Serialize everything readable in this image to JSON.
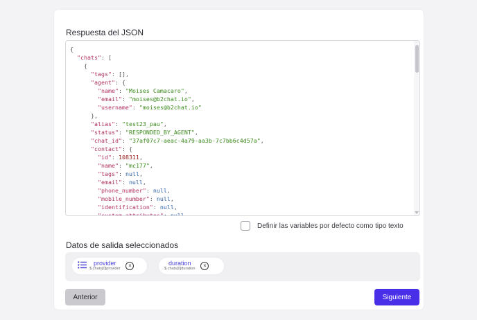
{
  "section_title": "Respuesta del JSON",
  "json_lines": [
    "{",
    "  \"chats\": [",
    "    {",
    "      \"tags\": [],",
    "      \"agent\": {",
    "        \"name\": \"Moises Camacaro\",",
    "        \"email\": \"moises@b2chat.io\",",
    "        \"username\": \"moises@b2chat.io\"",
    "      },",
    "      \"alias\": \"test23_pau\",",
    "      \"status\": \"RESPONDED_BY_AGENT\",",
    "      \"chat_id\": \"37af07c7-aeac-4a79-aa3b-7c7bb6c4d57a\",",
    "      \"contact\": {",
    "        \"id\": 108311,",
    "        \"name\": \"mc177\",",
    "        \"tags\": null,",
    "        \"email\": null,",
    "        \"phone_number\": null,",
    "        \"mobile_number\": null,",
    "        \"identification\": null,",
    "        \"custom_attributes\": null"
  ],
  "checkbox": {
    "label": "Definir las variables por defecto como tipo texto",
    "checked": false
  },
  "output_title": "Datos de salida seleccionados",
  "chips": [
    {
      "name": "provider",
      "path": "$.chats[0]provider",
      "icon": "list-icon"
    },
    {
      "name": "duration",
      "path": "$.chats[0]duration"
    }
  ],
  "buttons": {
    "previous": "Anterior",
    "next": "Siguiente"
  },
  "colors": {
    "primary": "#4a2fe8",
    "chip_text": "#4a3fd8",
    "json_key": "#b03060",
    "json_string": "#3a8a1a"
  }
}
